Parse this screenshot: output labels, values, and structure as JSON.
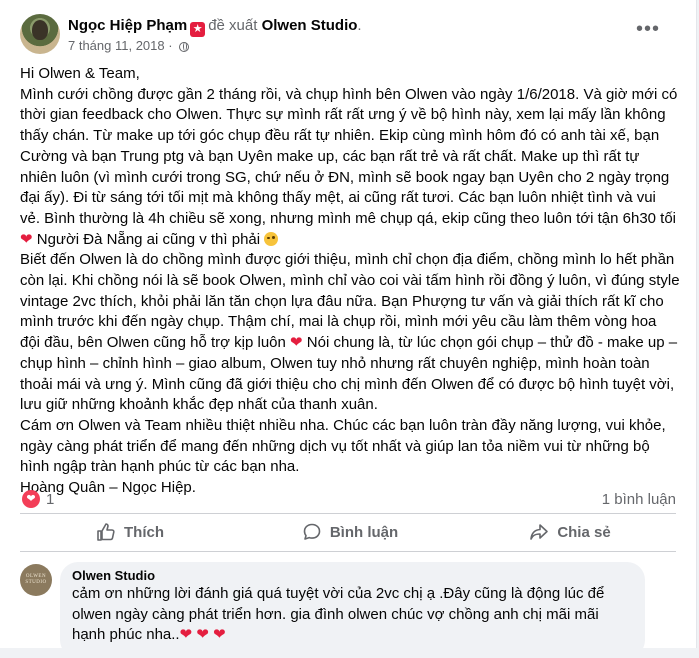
{
  "post": {
    "author": "Ngọc Hiệp Phạm",
    "recommend_text": "đề xuất",
    "page": "Olwen Studio",
    "page_suffix": ".",
    "date": "7 tháng 11, 2018",
    "date_sep": "·",
    "more": "•••",
    "lines": [
      "Hi Olwen & Team,",
      "Mình cưới chồng được gần 2 tháng rồi, và chụp hình bên Olwen vào ngày 1/6/2018. Và giờ mới có thời gian feedback cho Olwen. Thực sự mình rất rất ưng ý về bộ hình này, xem lại mấy lần không thấy chán. Từ make up tới góc chụp đều rất tự nhiên. Ekip cùng mình hôm đó có anh tài xế, bạn Cường và bạn Trung ptg và bạn Uyên make up, các bạn rất trẻ và rất chất. Make up thì rất tự nhiên luôn (vì mình cưới trong SG, chứ nếu ở ĐN, mình sẽ book ngay bạn Uyên cho 2 ngày trọng đại ấy). Đi từ sáng tới tối mịt mà không thấy mệt, ai cũng rất tươi. Các bạn luôn nhiệt tình và vui vẻ. Bình thường là 4h chiều sẽ xong, nhưng mình mê chụp qá, ekip cũng theo luôn tới tận 6h30 tối",
      "Người Đà Nẵng ai cũng v thì phải",
      "Biết đến Olwen là do chồng mình được giới thiệu, mình chỉ chọn địa điểm, chồng mình lo hết phần còn lại. Khi chồng nói là sẽ book Olwen, mình chỉ vào coi vài tấm hình rồi đồng ý luôn, vì đúng style vintage 2vc thích, khỏi phải lăn tăn chọn lựa đâu nữa. Bạn Phượng tư vấn và giải thích rất kĩ cho mình trước khi đến ngày chụp. Thậm chí, mai là chụp rồi, mình mới yêu cầu làm thêm vòng hoa đội đầu, bên Olwen cũng hỗ trợ kịp luôn",
      "Nói chung là, từ lúc chọn gói chụp – thử đồ - make up – chụp hình – chỉnh hình – giao album, Olwen tuy nhỏ nhưng rất chuyên nghiệp, mình hoàn toàn thoải mái và ưng ý. Mình cũng đã giới thiệu cho chị mình đến Olwen để có được bộ hình tuyệt vời, lưu giữ những khoảnh khắc đẹp nhất của thanh xuân.",
      "Cám ơn Olwen và Team nhiều thiệt nhiều nha. Chúc các bạn luôn tràn đầy năng lượng, vui khỏe, ngày càng phát triển để mang đến những dịch vụ tốt nhất và giúp lan tỏa niềm vui từ những bộ hình ngập tràn hạnh phúc từ các bạn nha.",
      "Hoàng Quân – Ngọc Hiệp."
    ],
    "heart": "❤",
    "reactions_count": "1",
    "comments_count": "1 bình luận"
  },
  "actions": {
    "like": "Thích",
    "comment": "Bình luận",
    "share": "Chia sẻ"
  },
  "comment": {
    "avatar_text": "OLWEN STUDIO",
    "author": "Olwen Studio",
    "text": "cảm ơn những lời đánh giá quá tuyệt vời của 2vc chị ạ .Đây cũng là động lúc để olwen ngày càng phát triển hơn. gia đình olwen chúc vợ chồng anh chị mãi mãi hạnh phúc nha..",
    "hearts": "❤ ❤ ❤"
  },
  "colors": {
    "accent_red": "#e41e3f",
    "secondary_text": "#65676b",
    "bubble_bg": "#f0f2f5"
  },
  "icons": [
    "globe-icon",
    "more-icon",
    "love-reaction-icon",
    "like-icon",
    "comment-icon",
    "share-icon",
    "recommend-icon",
    "wink-emoji-icon",
    "heart-emoji-icon"
  ]
}
